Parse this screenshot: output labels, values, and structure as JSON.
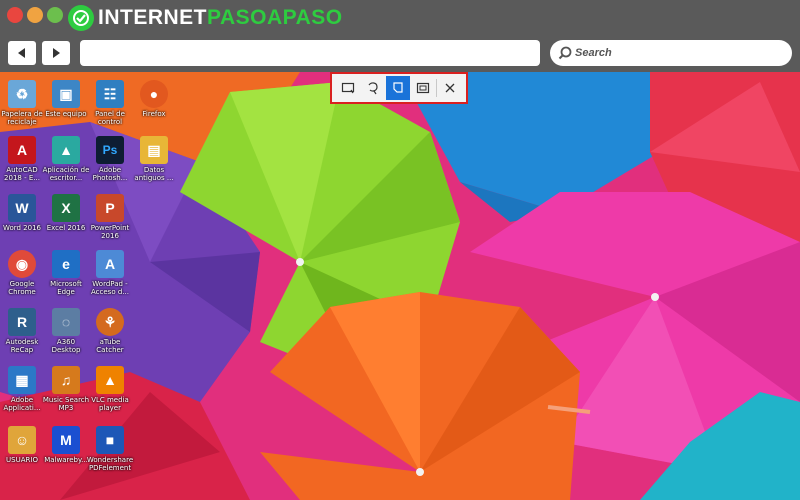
{
  "header": {
    "logo_text_a": "INTERNET",
    "logo_text_b": "PASOAPASO",
    "colors": {
      "brand_green": "#2ecc40"
    }
  },
  "toolbar": {
    "back_icon": "back-arrow-icon",
    "forward_icon": "forward-arrow-icon",
    "address_value": "",
    "search_placeholder": "Search"
  },
  "snip_toolbar": {
    "modes": [
      {
        "icon": "rectangular-snip-icon",
        "active": false
      },
      {
        "icon": "freeform-snip-icon",
        "active": false
      },
      {
        "icon": "window-snip-icon",
        "active": true
      },
      {
        "icon": "fullscreen-snip-icon",
        "active": false
      }
    ],
    "close_icon": "close-icon",
    "colors": {
      "highlight": "#d92020",
      "active": "#1a73d9"
    }
  },
  "desktop": {
    "icons": [
      {
        "label": "Papelera de reciclaje",
        "glyph": "♻",
        "color": "#6aa7d8"
      },
      {
        "label": "Este equipo",
        "glyph": "▣",
        "color": "#3d86c6"
      },
      {
        "label": "Panel de control",
        "glyph": "☷",
        "color": "#2f7fc1"
      },
      {
        "label": "Firefox",
        "glyph": "●",
        "color": "#e2581f"
      },
      {
        "label": "AutoCAD 2018 - E...",
        "glyph": "A",
        "color": "#c4161c"
      },
      {
        "label": "Aplicación de escritor...",
        "glyph": "▲",
        "color": "#2aa9a0"
      },
      {
        "label": "Adobe Photosh...",
        "glyph": "Ps",
        "color": "#0e1d33"
      },
      {
        "label": "Datos antiguos ...",
        "glyph": "▤",
        "color": "#e8b637"
      },
      {
        "label": "Word 2016",
        "glyph": "W",
        "color": "#2a5699"
      },
      {
        "label": "Excel 2016",
        "glyph": "X",
        "color": "#1f7244"
      },
      {
        "label": "PowerPoint 2016",
        "glyph": "P",
        "color": "#c8482b"
      },
      {
        "label": "Google Chrome",
        "glyph": "◉",
        "color": "#e04a3a"
      },
      {
        "label": "Microsoft Edge",
        "glyph": "e",
        "color": "#1f6fc5"
      },
      {
        "label": "WordPad - Acceso d...",
        "glyph": "A",
        "color": "#4d8ad6"
      },
      {
        "label": "Autodesk ReCap",
        "glyph": "R",
        "color": "#2e5f8c"
      },
      {
        "label": "A360 Desktop",
        "glyph": "◌",
        "color": "#5c7da3"
      },
      {
        "label": "aTube Catcher",
        "glyph": "⚘",
        "color": "#d46a1f"
      },
      {
        "label": "Adobe Applicati...",
        "glyph": "▦",
        "color": "#2b78c7"
      },
      {
        "label": "Music Search MP3",
        "glyph": "♫",
        "color": "#d67a1c"
      },
      {
        "label": "VLC media player",
        "glyph": "▲",
        "color": "#ef8200"
      },
      {
        "label": "USUARIO",
        "glyph": "☺",
        "color": "#e0a53a"
      },
      {
        "label": "Malwareby...",
        "glyph": "M",
        "color": "#1b4fd1"
      },
      {
        "label": "Wondershare PDFelement",
        "glyph": "■",
        "color": "#1d57b7"
      }
    ]
  }
}
